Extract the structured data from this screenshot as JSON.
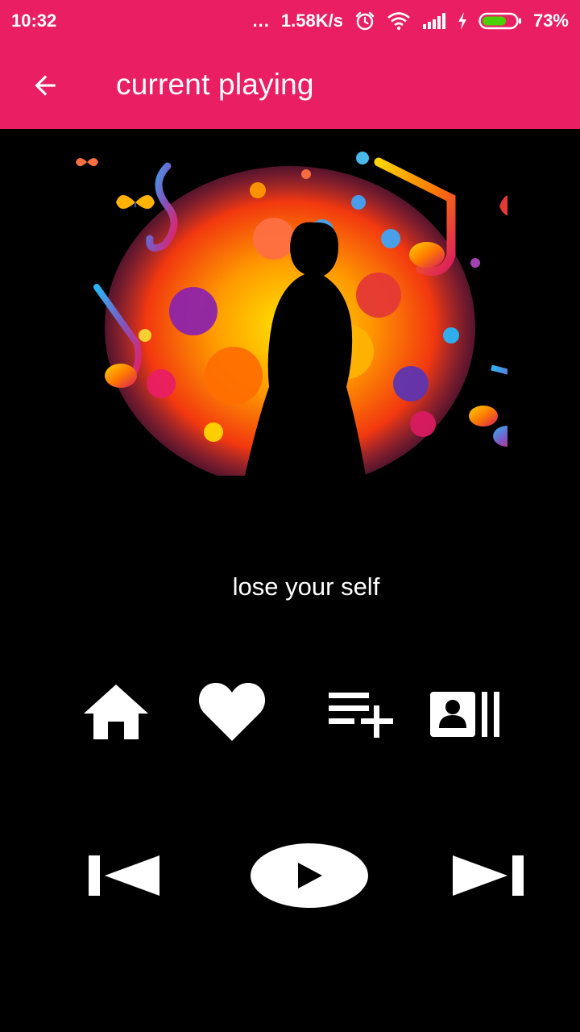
{
  "status_bar": {
    "time": "10:32",
    "more": "...",
    "net_speed": "1.58K/s",
    "battery_percent": "73%",
    "battery_level": 0.73,
    "icons": [
      "alarm-icon",
      "wifi-icon",
      "signal-icon",
      "charging-icon",
      "battery-icon"
    ]
  },
  "app_bar": {
    "title": "current playing",
    "back_icon": "arrow-back-icon",
    "color": "#E91E63"
  },
  "album_art": {
    "icon": "album-art"
  },
  "now_playing": {
    "song_title": "lose your self"
  },
  "actions": [
    {
      "name": "home",
      "icon": "home-icon"
    },
    {
      "name": "favorite",
      "icon": "heart-icon"
    },
    {
      "name": "add-to-playlist",
      "icon": "playlist-add-icon"
    },
    {
      "name": "contacts",
      "icon": "contact-card-icon"
    }
  ],
  "controls": [
    {
      "name": "previous",
      "icon": "skip-previous-icon"
    },
    {
      "name": "play",
      "icon": "play-icon"
    },
    {
      "name": "next",
      "icon": "skip-next-icon"
    }
  ]
}
